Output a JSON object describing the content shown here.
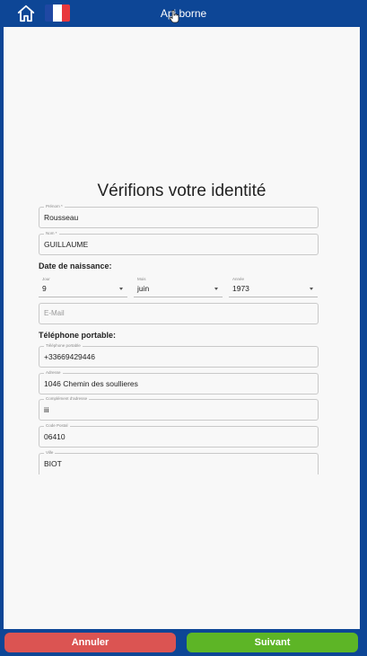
{
  "header": {
    "title": "Api borne",
    "home_icon": "home-icon",
    "flag_colors": [
      "#1f48a3",
      "#ffffff",
      "#e8383d"
    ]
  },
  "form": {
    "heading": "Vérifions votre identité",
    "prenom": {
      "label": "Prénom *",
      "value": "Rousseau"
    },
    "nom": {
      "label": "Nom *",
      "value": "GUILLAUME"
    },
    "dob_label": "Date de naissance:",
    "jour": {
      "label": "Jour",
      "value": "9"
    },
    "mois": {
      "label": "Mois",
      "value": "juin"
    },
    "annee": {
      "label": "Année",
      "value": "1973"
    },
    "email": {
      "placeholder": "E-Mail"
    },
    "phone_section": "Téléphone portable:",
    "telephone": {
      "label": "Téléphone portable",
      "value": "+33669429446"
    },
    "adresse": {
      "label": "Adresse",
      "value": "1046 Chemin des soullieres"
    },
    "complement": {
      "label": "Complément d'adresse",
      "value": "iii"
    },
    "code_postal": {
      "label": "Code Postal",
      "value": "06410"
    },
    "ville": {
      "label": "Ville",
      "value": "BIOT"
    }
  },
  "buttons": {
    "cancel": "Annuler",
    "next": "Suivant"
  },
  "colors": {
    "background": "#0d4696",
    "cancel": "#db5452",
    "next": "#5db526"
  }
}
